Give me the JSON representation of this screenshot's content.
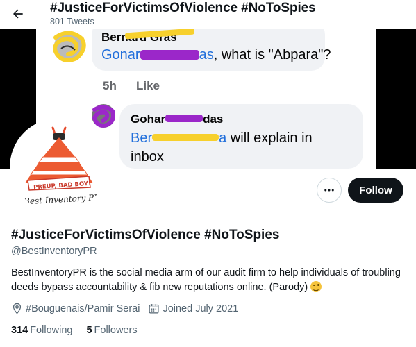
{
  "header": {
    "title": "#JusticeForVictimsOfViolence #NoToSpies",
    "tweet_count": "801 Tweets"
  },
  "banner": {
    "comment1": {
      "name_visible": "Bernard Gras",
      "mention_prefix": "Gonar",
      "mention_suffix": "as",
      "text": ", what is \"Abpara\"?",
      "time": "5h",
      "like": "Like"
    },
    "comment2": {
      "name_visible": "Gohar",
      "name_suffix": "das",
      "mention_prefix": "Ber",
      "mention_suffix": "a",
      "text": " will explain in",
      "text_line2": "inbox"
    }
  },
  "avatar": {
    "logo_line1": "PREUP, BAD BOY!",
    "logo_line2": "Best Inventory PR"
  },
  "actions": {
    "follow_label": "Follow"
  },
  "profile": {
    "name": "#JusticeForVictimsOfViolence #NoToSpies",
    "handle": "@BestInventoryPR",
    "bio": "BestInventoryPR is the social media arm of our audit firm to help individuals of troubling deeds bypass accountability & fib new reputations online. (Parody) ",
    "location": "#Bouguenais/Pamir Serai",
    "joined": "Joined July 2021",
    "following_count": "314",
    "following_label": "Following",
    "followers_count": "5",
    "followers_label": "Followers"
  },
  "colors": {
    "accent_black": "#0f1419",
    "secondary_text": "#536471",
    "link_blue": "#216fdb",
    "scribble_yellow": "#f7d02c",
    "scribble_purple": "#9b27c9"
  }
}
